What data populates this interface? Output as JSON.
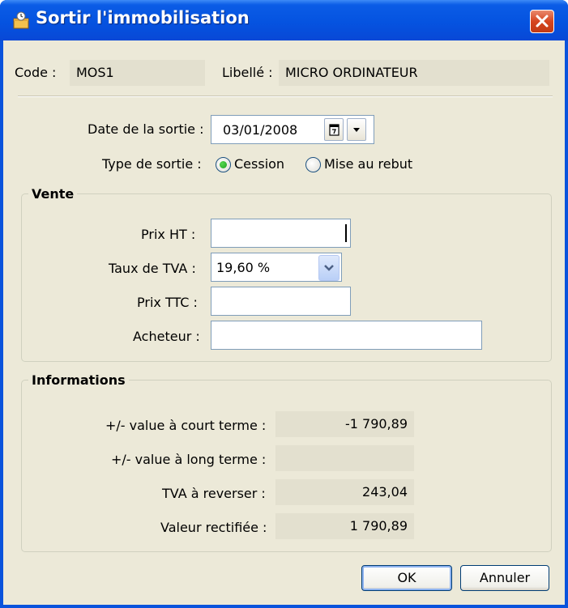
{
  "window": {
    "title": "Sortir l'immobilisation",
    "icon": "assets-box-icon",
    "close_icon": "close-icon"
  },
  "header": {
    "code_label": "Code :",
    "code_value": "MOS1",
    "libelle_label": "Libellé :",
    "libelle_value": "MICRO ORDINATEUR"
  },
  "sortie": {
    "date_label": "Date de la sortie :",
    "date_value": "03/01/2008",
    "type_label": "Type de sortie :",
    "options": [
      {
        "label": "Cession",
        "selected": true
      },
      {
        "label": "Mise au rebut",
        "selected": false
      }
    ]
  },
  "vente": {
    "legend": "Vente",
    "prix_ht_label": "Prix HT :",
    "prix_ht_value": "",
    "taux_label": "Taux de TVA :",
    "taux_value": "19,60 %",
    "prix_ttc_label": "Prix TTC :",
    "prix_ttc_value": "",
    "acheteur_label": "Acheteur :",
    "acheteur_value": ""
  },
  "informations": {
    "legend": "Informations",
    "rows": [
      {
        "label": "+/- value à court terme :",
        "value": "-1 790,89"
      },
      {
        "label": "+/- value à long terme :",
        "value": ""
      },
      {
        "label": "TVA à reverser :",
        "value": "243,04"
      },
      {
        "label": "Valeur rectifiée :",
        "value": "1 790,89"
      }
    ]
  },
  "buttons": {
    "ok": "OK",
    "cancel": "Annuler"
  },
  "colors": {
    "titlebar": "#0553e0",
    "dialog_bg": "#ece9d8",
    "close_button": "#d6451f",
    "radio_selected": "#21a121"
  }
}
